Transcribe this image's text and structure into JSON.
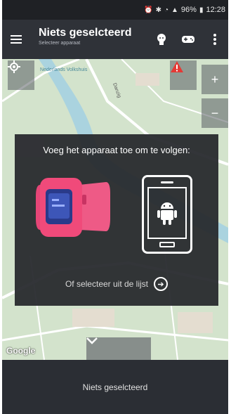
{
  "status_bar": {
    "time": "12:28",
    "battery": "96%",
    "icons": [
      "alarm-icon",
      "bluetooth-icon",
      "wifi-icon",
      "signal-icon",
      "battery-icon"
    ]
  },
  "app_bar": {
    "title": "Niets geselcteerd",
    "subtitle": "Selecteer apparaat",
    "actions": [
      "child-icon",
      "gamepad-icon",
      "more-vertical-icon"
    ]
  },
  "map": {
    "place_labels": [
      "Nederlands Volkshuis",
      "Danzig"
    ],
    "attribution": "Google",
    "buttons": {
      "zoom_in": "+",
      "zoom_out": "−"
    }
  },
  "dialog": {
    "title": "Voeg het apparaat toe om te volgen:",
    "select_label": "Of selecteer uit de lijst"
  },
  "bottom_panel": {
    "label": "Niets geselcteerd"
  },
  "colors": {
    "app_bar": "#2f3238",
    "map_bg": "#cfe0c7",
    "watch_pink": "#f04a7a",
    "dialog_bg": "#26282d"
  }
}
